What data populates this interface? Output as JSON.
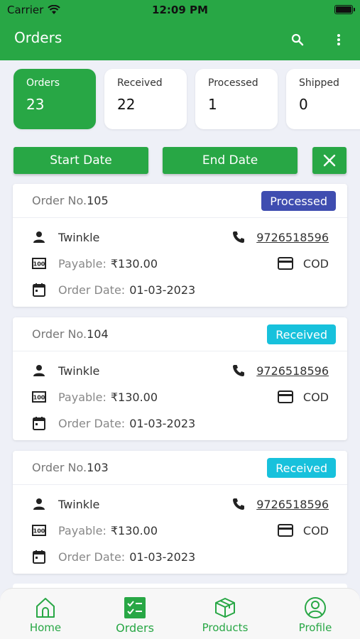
{
  "status_bar": {
    "carrier": "Carrier",
    "time": "12:09 PM"
  },
  "appbar": {
    "title": "Orders"
  },
  "stats": [
    {
      "label": "Orders",
      "value": "23"
    },
    {
      "label": "Received",
      "value": "22"
    },
    {
      "label": "Processed",
      "value": "1"
    },
    {
      "label": "Shipped",
      "value": "0"
    }
  ],
  "filters": {
    "start_label": "Start Date",
    "end_label": "End Date"
  },
  "colors": {
    "primary": "#28a745",
    "processed": "#3f4db0",
    "received": "#17c1dc"
  },
  "orders": [
    {
      "prefix": "Order No.",
      "number": "105",
      "status": "Processed",
      "name": "Twinkle",
      "phone": "9726518596",
      "payable_label": "Payable:",
      "payable": "₹130.00",
      "payment": "COD",
      "date_label": "Order Date:",
      "date": "01-03-2023"
    },
    {
      "prefix": "Order No.",
      "number": "104",
      "status": "Received",
      "name": "Twinkle",
      "phone": "9726518596",
      "payable_label": "Payable:",
      "payable": "₹130.00",
      "payment": "COD",
      "date_label": "Order Date:",
      "date": "01-03-2023"
    },
    {
      "prefix": "Order No.",
      "number": "103",
      "status": "Received",
      "name": "Twinkle",
      "phone": "9726518596",
      "payable_label": "Payable:",
      "payable": "₹130.00",
      "payment": "COD",
      "date_label": "Order Date:",
      "date": "01-03-2023"
    }
  ],
  "tabs": [
    {
      "label": "Home",
      "icon": "home-icon"
    },
    {
      "label": "Orders",
      "icon": "orders-checklist-icon"
    },
    {
      "label": "Products",
      "icon": "box-icon"
    },
    {
      "label": "Profile",
      "icon": "user-icon"
    }
  ]
}
